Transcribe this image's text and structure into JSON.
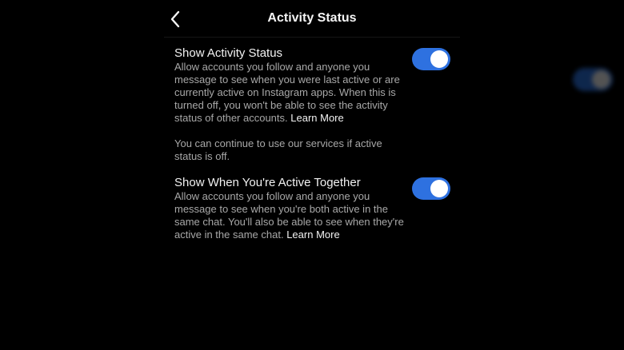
{
  "header": {
    "title": "Activity Status"
  },
  "activity_status": {
    "title": "Show Activity Status",
    "description": "Allow accounts you follow and anyone you message to see when you were last active or are currently active on Instagram apps. When this is turned off, you won't be able to see the activity status of other accounts.",
    "learn_more": "Learn More",
    "enabled": true
  },
  "note": {
    "text": "You can continue to use our services if active status is off."
  },
  "active_together": {
    "title": "Show When You're Active Together",
    "description": "Allow accounts you follow and anyone you message to see when you're both active in the same chat. You'll also be able to see when they're active in the same chat.",
    "learn_more": "Learn More",
    "enabled": true
  },
  "colors": {
    "background": "#000000",
    "toggle_on": "#2e71e0",
    "secondary_text": "#a8a8a8"
  },
  "icons": {
    "back": "chevron-left-icon"
  }
}
